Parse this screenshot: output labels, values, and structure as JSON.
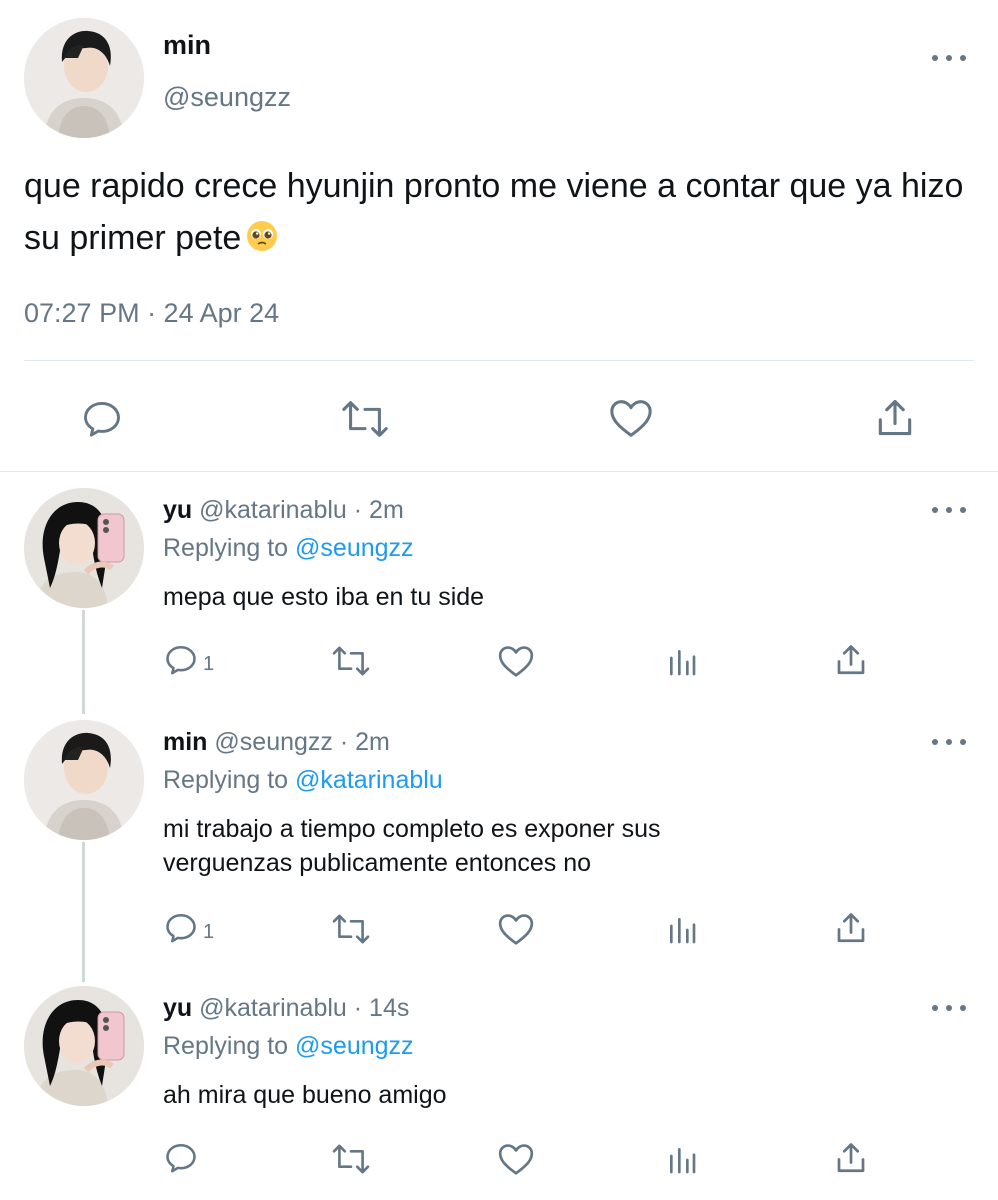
{
  "main_tweet": {
    "author_name": "min",
    "author_handle": "@seungzz",
    "text": "que rapido crece hyunjin pronto me viene a contar que ya hizo su primer pete",
    "emoji": "pleading-face",
    "timestamp": "07:27 PM · 24 Apr 24",
    "actions": [
      "reply-icon",
      "retweet-icon",
      "like-icon",
      "share-icon"
    ]
  },
  "replies": [
    {
      "author_name": "yu",
      "author_handle": "@katarinablu",
      "time": "· 2m",
      "replying_prefix": "Replying to",
      "replying_to": "@seungzz",
      "text": "mepa que esto iba en tu side",
      "reply_count": "1"
    },
    {
      "author_name": "min",
      "author_handle": "@seungzz",
      "time": "· 2m",
      "replying_prefix": "Replying to",
      "replying_to": "@katarinablu",
      "text_lines": [
        "mi trabajo a tiempo completo es exponer sus",
        "verguenzas publicamente entonces no"
      ],
      "reply_count": "1"
    },
    {
      "author_name": "yu",
      "author_handle": "@katarinablu",
      "time": "· 14s",
      "replying_prefix": "Replying to",
      "replying_to": "@seungzz",
      "text": "ah mira que bueno amigo",
      "reply_count": ""
    }
  ],
  "colors": {
    "text": "#0f1419",
    "muted": "#657786",
    "link": "#1d9bf0",
    "divider": "#e1e8ed"
  }
}
